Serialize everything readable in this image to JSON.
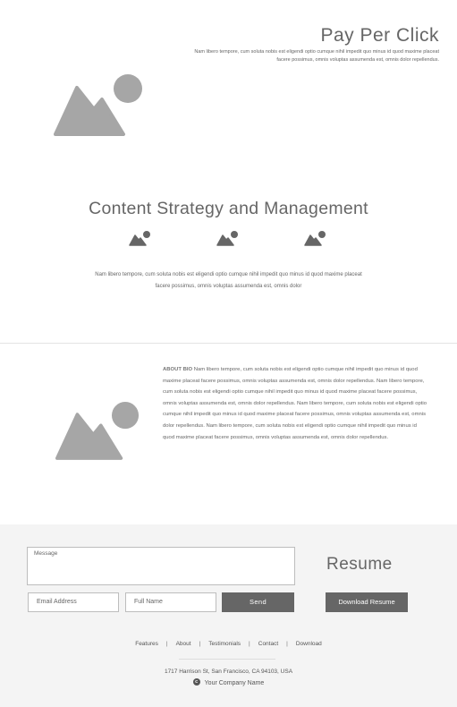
{
  "ppc": {
    "title": "Pay Per Click",
    "text": "Nam libero tempore, cum soluta nobis est eligendi optio cumque nihil impedit quo minus id quod maxime placeat facere possimus, omnis voluptas assumenda est, omnis dolor repellendus."
  },
  "content_strategy": {
    "title": "Content Strategy and Management",
    "text": "Nam libero tempore, cum soluta nobis est eligendi optio cumque nihil impedit quo minus id quod maxime placeat facere possimus, omnis voluptas assumenda est, omnis dolor"
  },
  "about": {
    "label": "ABOUT BIO",
    "text": " Nam libero tempore, cum soluta nobis est eligendi optio cumque nihil impedit quo minus id quod maxime placeat facere possimus, omnis voluptas assumenda est, omnis dolor repellendus.  Nam libero tempore, cum soluta nobis est eligendi optio cumque nihil impedit quo minus id quod maxime placeat facere possimus, omnis voluptas assumenda est, omnis dolor repellendus.  Nam libero tempore, cum soluta nobis est eligendi optio cumque nihil impedit quo minus id quod maxime placeat facere possimus, omnis voluptas assumenda est, omnis dolor repellendus.  Nam libero tempore, cum soluta nobis est eligendi optio cumque nihil impedit quo minus id quod maxime placeat facere possimus, omnis voluptas assumenda est, omnis dolor repellendus."
  },
  "contact": {
    "message_label": "Message",
    "email_placeholder": "Email Address",
    "name_placeholder": "Full Name",
    "send_label": "Send"
  },
  "resume": {
    "title": "Resume",
    "download_label": "Download Resume"
  },
  "footer": {
    "nav": [
      "Features",
      "About",
      "Testimonials",
      "Contact",
      "Download"
    ],
    "address": "1717 Harrison St, San Francisco, CA 94103, USA",
    "copyright_symbol": "c",
    "company": "Your Company Name"
  },
  "colors": {
    "placeholder_gray": "#a6a6a6",
    "icon_dark": "#666666",
    "button_bg": "#666666",
    "footer_bg": "#f4f4f4"
  }
}
